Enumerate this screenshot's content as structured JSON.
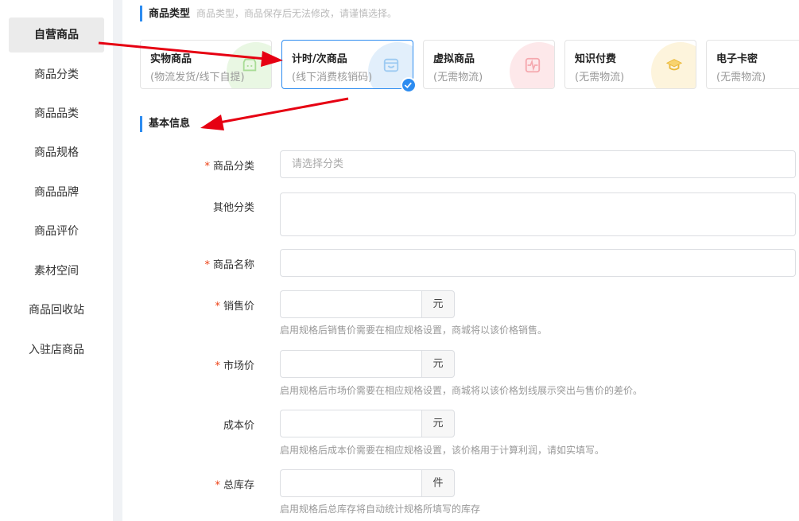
{
  "sidebar": {
    "items": [
      {
        "label": "自营商品",
        "active": true
      },
      {
        "label": "商品分类"
      },
      {
        "label": "商品品类"
      },
      {
        "label": "商品规格"
      },
      {
        "label": "商品品牌"
      },
      {
        "label": "商品评价"
      },
      {
        "label": "素材空间"
      },
      {
        "label": "商品回收站"
      },
      {
        "label": "入驻店商品"
      }
    ]
  },
  "product_type": {
    "title": "商品类型",
    "hint": "商品类型，商品保存后无法修改，请谨慎选择。",
    "cards": [
      {
        "title": "实物商品",
        "sub": "(物流发货/线下自提)",
        "icon": "shop-icon",
        "color": "#e9f7e3"
      },
      {
        "title": "计时/次商品",
        "sub": "(线下消费核销码)",
        "icon": "bag-icon",
        "color": "#e2effb",
        "selected": true
      },
      {
        "title": "虚拟商品",
        "sub": "(无需物流)",
        "icon": "pulse-icon",
        "color": "#fde8ea"
      },
      {
        "title": "知识付费",
        "sub": "(无需物流)",
        "icon": "graduation-cap-icon",
        "color": "#fdf4dc"
      },
      {
        "title": "电子卡密",
        "sub": "(无需物流)",
        "icon": "card-icon",
        "color": "#f1e9fb"
      }
    ]
  },
  "basic_info": {
    "title": "基本信息",
    "fields": {
      "category": {
        "label": "商品分类",
        "placeholder": "请选择分类",
        "required": true
      },
      "other_category": {
        "label": "其他分类"
      },
      "name": {
        "label": "商品名称",
        "required": true
      },
      "sale_price": {
        "label": "销售价",
        "unit": "元",
        "required": true,
        "hint": "启用规格后销售价需要在相应规格设置，商城将以该价格销售。"
      },
      "market_price": {
        "label": "市场价",
        "unit": "元",
        "required": true,
        "hint": "启用规格后市场价需要在相应规格设置，商城将以该价格划线展示突出与售价的差价。"
      },
      "cost_price": {
        "label": "成本价",
        "unit": "元",
        "hint": "启用规格后成本价需要在相应规格设置，该价格用于计算利润，请如实填写。"
      },
      "stock": {
        "label": "总库存",
        "unit": "件",
        "required": true,
        "hint": "启用规格后总库存将自动统计规格所填写的库存"
      }
    }
  },
  "colors": {
    "accent": "#2d8cf0",
    "required": "#ed4014",
    "annotation": "#e60012"
  }
}
